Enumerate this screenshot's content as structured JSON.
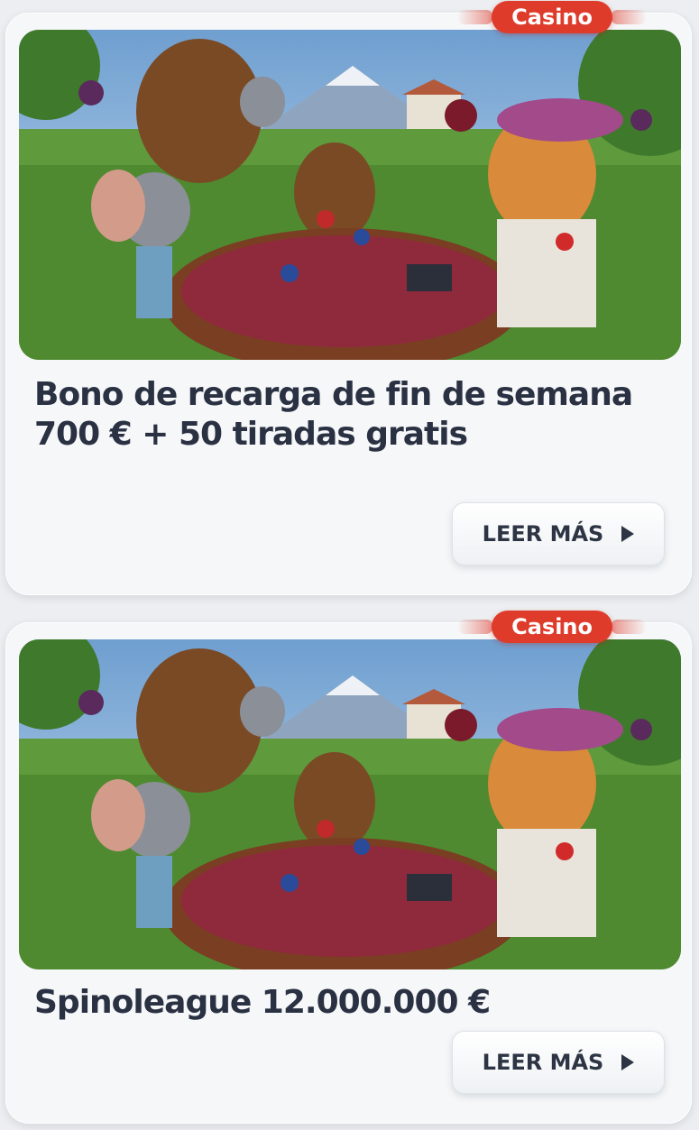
{
  "promotions": [
    {
      "badge": "Casino",
      "title_line1": "Bono de recarga de fin de semana",
      "title_line2": "700 € + 50 tiradas gratis",
      "button_label": "LEER MÁS",
      "image_icon": "casino-illustration"
    },
    {
      "badge": "Casino",
      "title_line1": "Spinoleague 12.000.000 €",
      "title_line2": "",
      "button_label": "LEER MÁS",
      "image_icon": "casino-illustration"
    }
  ],
  "colors": {
    "badge": "#de3b2b",
    "title": "#2a3142",
    "card": "#f6f7f8",
    "page": "#eceef1"
  }
}
